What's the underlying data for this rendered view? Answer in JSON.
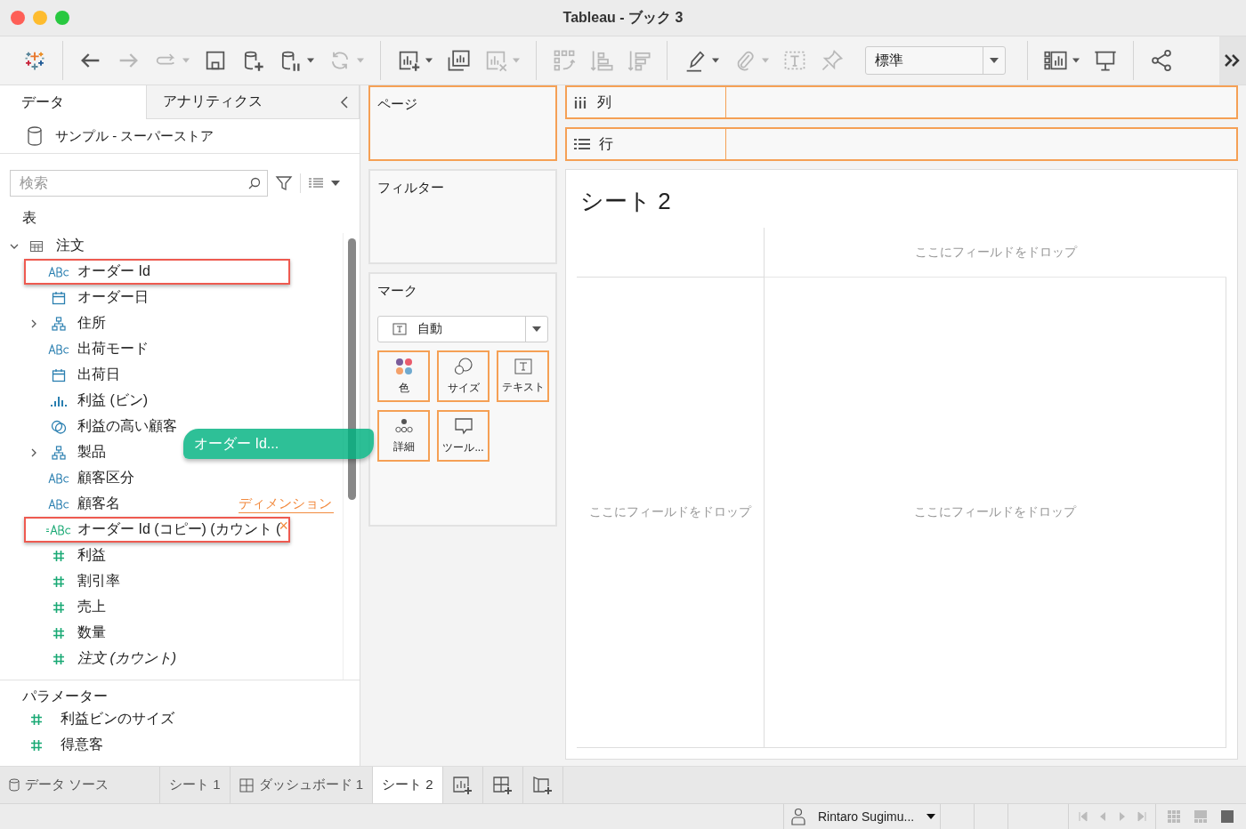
{
  "window": {
    "title": "Tableau - ブック 3"
  },
  "toolbar": [
    {
      "kind": "logo",
      "menu": false
    },
    {
      "kind": "separator"
    },
    {
      "kind": "back",
      "disabled": false,
      "menu": false
    },
    {
      "kind": "forward",
      "disabled": true,
      "menu": false
    },
    {
      "kind": "redo",
      "disabled": true,
      "menu": true
    },
    {
      "kind": "save",
      "disabled": false,
      "menu": false
    },
    {
      "kind": "datasource-add",
      "disabled": false,
      "menu": false
    },
    {
      "kind": "datasource-pause",
      "disabled": false,
      "menu": true
    },
    {
      "kind": "refresh",
      "disabled": true,
      "menu": true
    },
    {
      "kind": "separator"
    },
    {
      "kind": "new-sheet",
      "disabled": false,
      "menu": true
    },
    {
      "kind": "duplicate",
      "disabled": false,
      "menu": false
    },
    {
      "kind": "clear",
      "disabled": true,
      "menu": true
    },
    {
      "kind": "separator"
    },
    {
      "kind": "swap",
      "disabled": true,
      "menu": false
    },
    {
      "kind": "sort-asc",
      "disabled": true,
      "menu": false
    },
    {
      "kind": "sort-desc",
      "disabled": true,
      "menu": false
    },
    {
      "kind": "separator"
    },
    {
      "kind": "highlight",
      "disabled": false,
      "menu": true
    },
    {
      "kind": "attach",
      "disabled": true,
      "menu": true
    },
    {
      "kind": "textbox",
      "disabled": true,
      "menu": false
    },
    {
      "kind": "pin",
      "disabled": true,
      "menu": false
    },
    {
      "kind": "select",
      "value": "標準"
    },
    {
      "kind": "separator"
    },
    {
      "kind": "show-me",
      "disabled": false,
      "menu": true
    },
    {
      "kind": "presentation",
      "disabled": false,
      "menu": false
    },
    {
      "kind": "separator"
    },
    {
      "kind": "share",
      "disabled": false,
      "menu": false
    }
  ],
  "data_pane": {
    "tabs": [
      {
        "label": "データ",
        "selected": true
      },
      {
        "label": "アナリティクス",
        "selected": false
      }
    ],
    "datasource": "サンプル - スーパーストア",
    "search": {
      "placeholder": "検索"
    },
    "section": "表",
    "tree": [
      {
        "kind": "table",
        "label": "注文",
        "expanded": true,
        "children": [
          {
            "kind": "abc",
            "label": "オーダー Id",
            "highlighted": true
          },
          {
            "kind": "date",
            "label": "オーダー日",
            "highlighted": false
          },
          {
            "kind": "hierarchy",
            "label": "住所",
            "highlighted": false,
            "expanded": false
          },
          {
            "kind": "abc",
            "label": "出荷モード",
            "highlighted": false
          },
          {
            "kind": "date",
            "label": "出荷日",
            "highlighted": false
          },
          {
            "kind": "bin",
            "label": "利益 (ビン)",
            "highlighted": false
          },
          {
            "kind": "set",
            "label": "利益の高い顧客",
            "highlighted": false
          },
          {
            "kind": "hierarchy",
            "label": "製品",
            "highlighted": false,
            "expanded": false
          },
          {
            "kind": "abc",
            "label": "顧客区分",
            "highlighted": false
          },
          {
            "kind": "abc",
            "label": "顧客名",
            "highlighted": false,
            "drop_hint": "ディメンション"
          },
          {
            "kind": "calc-abc",
            "label": "オーダー Id (コピー) (カウント (",
            "highlighted": true,
            "remove_glyph": "×"
          },
          {
            "kind": "measure",
            "label": "利益",
            "highlighted": false
          },
          {
            "kind": "measure",
            "label": "割引率",
            "highlighted": false
          },
          {
            "kind": "measure",
            "label": "売上",
            "highlighted": false
          },
          {
            "kind": "measure",
            "label": "数量",
            "highlighted": false
          },
          {
            "kind": "measure",
            "label": "注文 (カウント)",
            "highlighted": false,
            "italic": true
          }
        ]
      }
    ],
    "parameters": {
      "title": "パラメーター",
      "items": [
        {
          "kind": "measure",
          "label": "利益ビンのサイズ"
        },
        {
          "kind": "measure",
          "label": "得意客"
        }
      ]
    }
  },
  "drag_ghost": {
    "label": "オーダー Id..."
  },
  "cards": {
    "pages": {
      "title": "ページ"
    },
    "filters": {
      "title": "フィルター"
    },
    "marks": {
      "title": "マーク",
      "type": "自動",
      "buttons": [
        {
          "kind": "color",
          "label": "色"
        },
        {
          "kind": "size",
          "label": "サイズ"
        },
        {
          "kind": "text",
          "label": "テキスト"
        },
        {
          "kind": "detail",
          "label": "詳細"
        },
        {
          "kind": "tooltip",
          "label": "ツール..."
        }
      ]
    }
  },
  "shelves": [
    {
      "kind": "columns",
      "label": "列"
    },
    {
      "kind": "rows",
      "label": "行"
    }
  ],
  "view": {
    "title": "シート 2",
    "drop_top": "ここにフィールドをドロップ",
    "drop_left": "ここにフィールドをドロップ",
    "drop_center": "ここにフィールドをドロップ"
  },
  "sheet_tabs": [
    {
      "kind": "datasource",
      "label": "データ ソース",
      "selected": false
    },
    {
      "kind": "sheet",
      "label": "シート 1",
      "selected": false
    },
    {
      "kind": "dashboard",
      "label": "ダッシュボード 1",
      "selected": false
    },
    {
      "kind": "sheet",
      "label": "シート 2",
      "selected": true
    }
  ],
  "status_bar": {
    "user": "Rintaro Sugimu..."
  }
}
